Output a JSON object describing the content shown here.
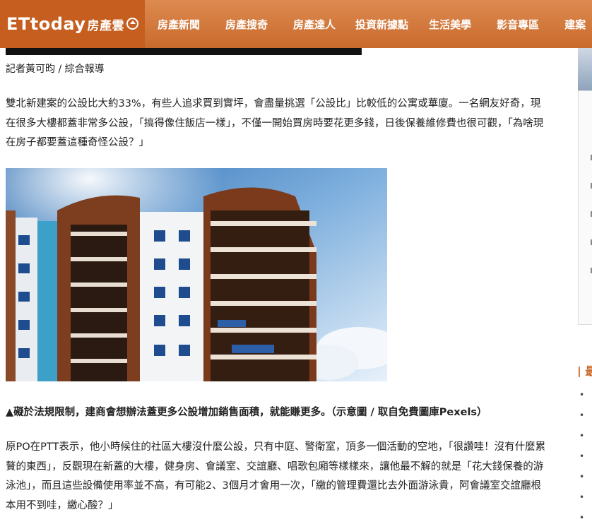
{
  "header": {
    "logo": "ETtoday",
    "logo_sub": "房產雲",
    "nav": [
      "房產新聞",
      "房產搜奇",
      "房產達人",
      "投資新據點",
      "生活美學",
      "影音專區",
      "建案"
    ]
  },
  "article": {
    "byline": "記者黃可昀 / 綜合報導",
    "paragraph1": "雙北新建案的公設比大約33%，有些人追求買到實坪，會盡量挑選「公設比」比較低的公寓或華廈。一名網友好奇，現在很多大樓都蓋非常多公設，「搞得像住飯店一樣」，不僅一開始買房時要花更多錢，日後保養維修費也很可觀，「為啥現在房子都要蓋這種奇怪公設？」",
    "photo_icon": "apartment-building-photo",
    "caption": "▲礙於法規限制，建商會想辦法蓋更多公設增加銷售面積，就能賺更多。（示意圖 / 取自免費圖庫Pexels）",
    "paragraph2": "原PO在PTT表示，他小時候住的社區大樓沒什麼公設，只有中庭、警衛室，頂多一個活動的空地，「很讚哇！沒有什麼累贅的東西」，反觀現在新蓋的大樓，健身房、會議室、交誼廳、唱歌包廂等樣樣來，讓他最不解的就是「花大錢保養的游泳池」，而且這些設備使用率並不高，有可能2、3個月才會用一次，「繳的管理費還比去外面游泳貴，阿會議室交誼廳根本用不到哇，繳心酸？」"
  },
  "sidebar": {
    "heading": "| 最",
    "bullets": [
      "•",
      "•",
      "•",
      "•",
      "•",
      "•",
      "•"
    ]
  },
  "colors": {
    "brand": "#c96a2c",
    "nav_bg": "#d57a3c"
  }
}
